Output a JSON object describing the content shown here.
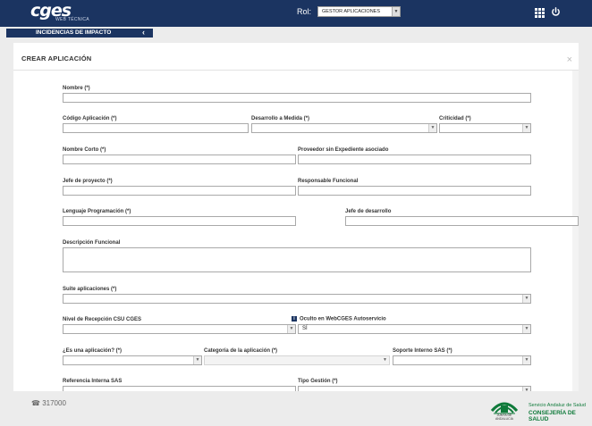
{
  "header": {
    "logo_text": "cges",
    "logo_sub": "WEB TÉCNICA",
    "rol_label": "Rol:",
    "rol_value": "GESTOR APLICACIONES",
    "grid_icon": "apps-grid-icon",
    "power_icon": "power-icon"
  },
  "breadcrumb": {
    "label": "INCIDENCIAS DE IMPACTO",
    "chevron": "‹"
  },
  "modal": {
    "title": "CREAR APLICACIÓN",
    "close": "×",
    "fields": {
      "nombre": "Nombre (*)",
      "codigo": "Código Aplicación (*)",
      "desarrollo": "Desarrollo a Medida (*)",
      "criticidad": "Criticidad (*)",
      "nombre_corto": "Nombre Corto (*)",
      "proveedor": "Proveedor sin Expediente asociado",
      "jefe_proyecto": "Jefe de proyecto (*)",
      "responsable": "Responsable Funcional",
      "lenguaje": "Lenguaje Programación (*)",
      "jefe_desarrollo": "Jefe de desarrollo",
      "descripcion": "Descripción Funcional",
      "suite": "Suite aplicaciones (*)",
      "nivel": "Nivel de Recepción CSU CGES",
      "oculto": "Oculto en WebCGES Autoservicio",
      "oculto_value": "SÍ",
      "es_aplicacion": "¿Es una aplicación? (*)",
      "categoria": "Categoría de la aplicación (*)",
      "soporte": "Soporte Interno SAS (*)",
      "referencia": "Referencia Interna SAS",
      "tipo_gestion": "Tipo Gestión (*)"
    }
  },
  "footer": {
    "phone_icon": "phone-icon",
    "phone": "317000",
    "junta_label": "JUNTA DE ANDALUCIA",
    "sas_line1": "Servicio Andaluz de Salud",
    "sas_line2": "CONSEJERÍA DE SALUD"
  },
  "colors": {
    "header_bg": "#1b3461",
    "page_bg": "#ececec",
    "brand_green": "#0f7a3a"
  }
}
